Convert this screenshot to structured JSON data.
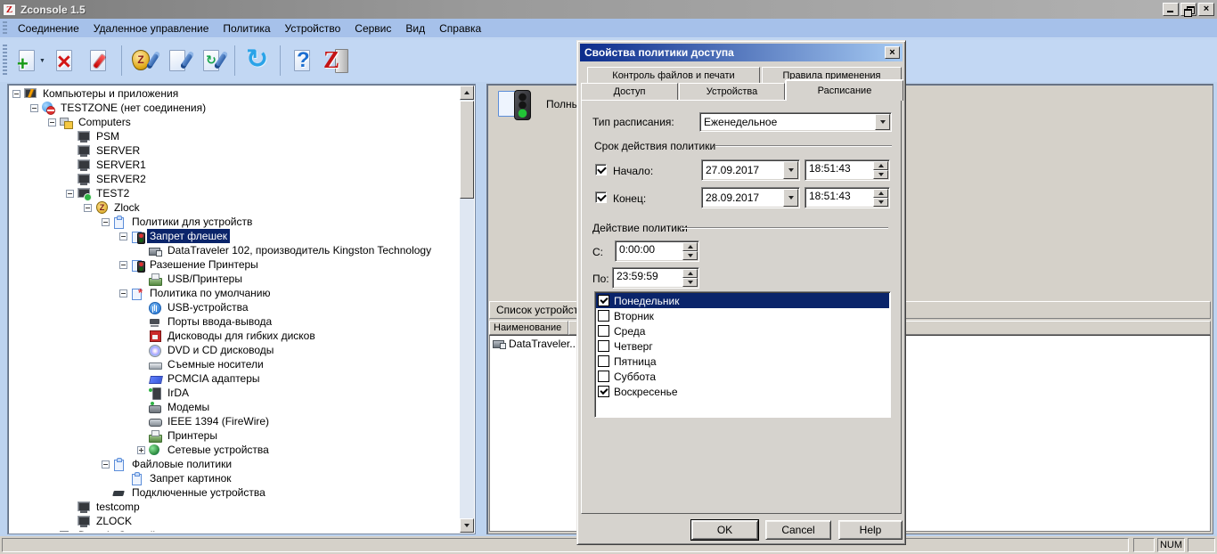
{
  "window": {
    "title": "Zconsole 1.5",
    "buttons": [
      "minimize",
      "restore",
      "close"
    ]
  },
  "colors": {
    "selection": "#0a246a",
    "dialog_title_gradient_start": "#0b2c8c",
    "dialog_title_gradient_end": "#a5c9f2",
    "toolbar_bg": "#c2d7f3",
    "menubar_bg": "#a6c1ea",
    "chrome_gray": "#d6d3ce"
  },
  "menu": {
    "items": [
      "Соединение",
      "Удаленное управление",
      "Политика",
      "Устройство",
      "Сервис",
      "Вид",
      "Справка"
    ]
  },
  "toolbar": {
    "buttons": [
      {
        "name": "new-policy-button",
        "icon": "new-document-icon",
        "kind": "doc-new",
        "dropdown": true
      },
      {
        "name": "delete-policy-button",
        "icon": "delete-document-icon",
        "kind": "doc-delete"
      },
      {
        "name": "edit-policy-button",
        "icon": "edit-document-icon",
        "kind": "doc-edit"
      },
      {
        "separator": true
      },
      {
        "name": "zlock-settings-button",
        "icon": "shield-wrench-icon",
        "kind": "shield-wrench"
      },
      {
        "name": "apply-config-button",
        "icon": "document-wrench-icon",
        "kind": "doc-wrench"
      },
      {
        "name": "sync-config-button",
        "icon": "sync-document-wrench-icon",
        "kind": "doc-sync"
      },
      {
        "separator": true
      },
      {
        "name": "refresh-button",
        "icon": "refresh-icon",
        "kind": "refresh"
      },
      {
        "separator": true
      },
      {
        "name": "help-button",
        "icon": "help-icon",
        "kind": "help"
      },
      {
        "name": "about-zlock-button",
        "icon": "zlock-logo-icon",
        "kind": "zlogo"
      }
    ]
  },
  "tree": {
    "items": [
      {
        "label": "Компьютеры и приложения",
        "level": 0,
        "expand": "minus",
        "icon": "apps-computer-icon"
      },
      {
        "label": "TESTZONE (нет соединения)",
        "level": 1,
        "expand": "minus",
        "icon": "zone-offline-icon"
      },
      {
        "label": "Computers",
        "level": 2,
        "expand": "minus",
        "icon": "computers-group-icon"
      },
      {
        "label": "PSM",
        "level": 3,
        "expand": "none",
        "icon": "computer-icon"
      },
      {
        "label": "SERVER",
        "level": 3,
        "expand": "none",
        "icon": "computer-icon"
      },
      {
        "label": "SERVER1",
        "level": 3,
        "expand": "none",
        "icon": "computer-icon"
      },
      {
        "label": "SERVER2",
        "level": 3,
        "expand": "none",
        "icon": "computer-icon"
      },
      {
        "label": "TEST2",
        "level": 3,
        "expand": "minus",
        "icon": "computer-online-icon"
      },
      {
        "label": "Zlock",
        "level": 4,
        "expand": "minus",
        "icon": "zlock-shield-icon"
      },
      {
        "label": "Политики для устройств",
        "level": 5,
        "expand": "minus",
        "icon": "device-policies-icon"
      },
      {
        "label": "Запрет флешек",
        "level": 6,
        "expand": "minus",
        "icon": "policy-flash-deny-icon",
        "selected": true
      },
      {
        "label": "DataTraveler 102, производитель Kingston Technology",
        "level": 7,
        "expand": "none",
        "icon": "flash-drive-icon"
      },
      {
        "label": "Разешение Принтеры",
        "level": 6,
        "expand": "minus",
        "icon": "policy-printer-allow-icon"
      },
      {
        "label": "USB/Принтеры",
        "level": 7,
        "expand": "none",
        "icon": "printer-icon"
      },
      {
        "label": "Политика по умолчанию",
        "level": 6,
        "expand": "minus",
        "icon": "default-policy-icon"
      },
      {
        "label": "USB-устройства",
        "level": 7,
        "expand": "none",
        "icon": "usb-icon"
      },
      {
        "label": "Порты ввода-вывода",
        "level": 7,
        "expand": "none",
        "icon": "io-ports-icon"
      },
      {
        "label": "Дисководы для гибких дисков",
        "level": 7,
        "expand": "none",
        "icon": "floppy-icon"
      },
      {
        "label": "DVD и CD дисководы",
        "level": 7,
        "expand": "none",
        "icon": "cd-icon"
      },
      {
        "label": "Съемные носители",
        "level": 7,
        "expand": "none",
        "icon": "removable-icon"
      },
      {
        "label": "PCMCIA адаптеры",
        "level": 7,
        "expand": "none",
        "icon": "pcmcia-icon"
      },
      {
        "label": "IrDA",
        "level": 7,
        "expand": "none",
        "icon": "irda-icon"
      },
      {
        "label": "Модемы",
        "level": 7,
        "expand": "none",
        "icon": "modem-icon"
      },
      {
        "label": "IEEE 1394 (FireWire)",
        "level": 7,
        "expand": "none",
        "icon": "firewire-icon"
      },
      {
        "label": "Принтеры",
        "level": 7,
        "expand": "none",
        "icon": "printer-icon"
      },
      {
        "label": "Сетевые устройства",
        "level": 7,
        "expand": "plus",
        "icon": "network-devices-icon"
      },
      {
        "label": "Файловые политики",
        "level": 5,
        "expand": "minus",
        "icon": "file-policies-icon"
      },
      {
        "label": "Запрет картинок",
        "level": 6,
        "expand": "none",
        "icon": "image-deny-policy-icon"
      },
      {
        "label": "Подключенные устройства",
        "level": 5,
        "expand": "none",
        "icon": "connected-devices-icon"
      },
      {
        "label": "testcomp",
        "level": 3,
        "expand": "none",
        "icon": "computer-icon"
      },
      {
        "label": "ZLOCK",
        "level": 3,
        "expand": "none",
        "icon": "computer-icon"
      },
      {
        "label": "Domain Controllers",
        "level": 2,
        "expand": "plus",
        "icon": "computers-group-icon"
      }
    ]
  },
  "device_panel": {
    "policy_caption": "Полнь",
    "toolbar_label": "Список устройств",
    "column_header": "Наименование",
    "items": [
      {
        "name": "DataTraveler..",
        "icon": "flash-drive-icon"
      }
    ]
  },
  "dialog": {
    "title": "Свойства политики доступа",
    "tabs_row1": [
      "Контроль файлов и печати",
      "Правила применения"
    ],
    "tabs_row2": [
      "Доступ",
      "Устройства"
    ],
    "active_tab": "Расписание",
    "schedule_type_label": "Тип расписания:",
    "schedule_type_value": "Еженедельное",
    "validity_group_label": "Срок действия политики",
    "start": {
      "label": "Начало:",
      "checked": true,
      "date": "27.09.2017",
      "time": "18:51:43"
    },
    "end": {
      "label": "Конец:",
      "checked": true,
      "date": "28.09.2017",
      "time": "18:51:43"
    },
    "action_group_label": "Действие политики",
    "from_label": "С:",
    "from_value": "0:00:00",
    "to_label": "По:",
    "to_value": "23:59:59",
    "days": [
      {
        "label": "Понедельник",
        "checked": true,
        "selected": true
      },
      {
        "label": "Вторник",
        "checked": false
      },
      {
        "label": "Среда",
        "checked": false
      },
      {
        "label": "Четверг",
        "checked": false
      },
      {
        "label": "Пятница",
        "checked": false
      },
      {
        "label": "Суббота",
        "checked": false
      },
      {
        "label": "Воскресенье",
        "checked": true
      }
    ],
    "buttons": [
      "OK",
      "Cancel",
      "Help"
    ]
  },
  "status_bar": {
    "num_indicator": "NUM"
  }
}
